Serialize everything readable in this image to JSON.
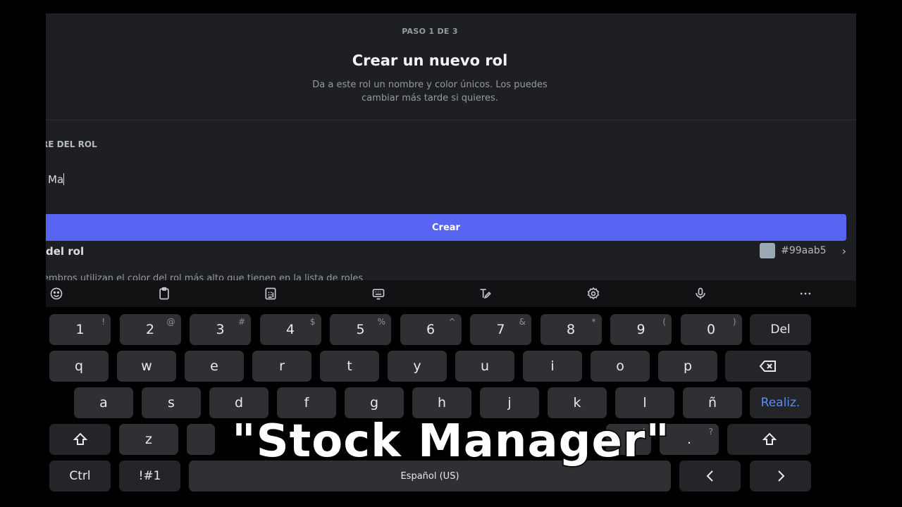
{
  "dialog": {
    "step": "PASO 1 DE 3",
    "title": "Crear un nuevo rol",
    "subtitle_line1": "Da a este rol un nombre y color únicos. Los puedes",
    "subtitle_line2": "cambiar más tarde si quieres.",
    "name_label": "RE DEL ROL",
    "name_value": "Ma",
    "create_label": "Crear",
    "color_label": "del rol",
    "color_hex": "#99aab5",
    "color_hint": "embros utilizan el color del rol más alto que tienen en la lista de roles"
  },
  "toolbar": {
    "icons": [
      "emoji-icon",
      "clipboard-icon",
      "keypad-icon",
      "keyboard-icon",
      "handwriting-icon",
      "gear-icon",
      "microphone-icon",
      "more-icon"
    ]
  },
  "keyboard": {
    "row1": [
      {
        "k": "1",
        "s": "!"
      },
      {
        "k": "2",
        "s": "@"
      },
      {
        "k": "3",
        "s": "#"
      },
      {
        "k": "4",
        "s": "$"
      },
      {
        "k": "5",
        "s": "%"
      },
      {
        "k": "6",
        "s": "^"
      },
      {
        "k": "7",
        "s": "&"
      },
      {
        "k": "8",
        "s": "*"
      },
      {
        "k": "9",
        "s": "("
      },
      {
        "k": "0",
        "s": ")"
      }
    ],
    "del_label": "Del",
    "row2": [
      "q",
      "w",
      "e",
      "r",
      "t",
      "y",
      "u",
      "i",
      "o",
      "p"
    ],
    "row3": [
      "a",
      "s",
      "d",
      "f",
      "g",
      "h",
      "j",
      "k",
      "l",
      "ñ"
    ],
    "enter_label": "Realiz.",
    "row4_left": "z",
    "row4_right": [
      {
        "k": "!",
        "s": ""
      },
      {
        "k": ".",
        "s": "?"
      }
    ],
    "ctrl_label": "Ctrl",
    "sym_label": "!#1",
    "space_label": "Español (US)"
  },
  "caption": "\"Stock Manager\""
}
